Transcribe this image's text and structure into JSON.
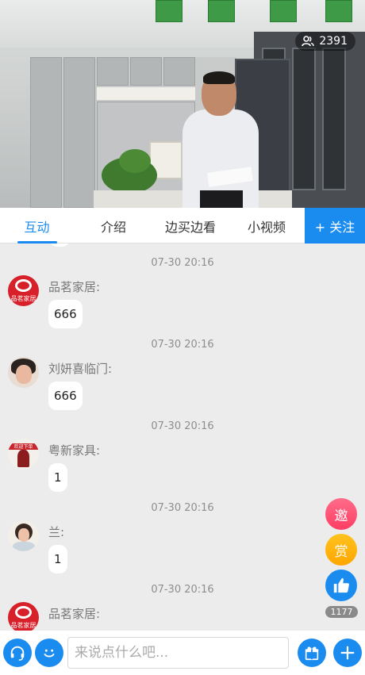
{
  "live": {
    "viewer_count": "2391"
  },
  "tabs": [
    {
      "label": "互动"
    },
    {
      "label": "介绍"
    },
    {
      "label": "边买边看"
    },
    {
      "label": "小视频"
    }
  ],
  "follow_label": "+ 关注",
  "messages": [
    {
      "time": "07-30 20:16",
      "name": "品茗家居:",
      "text": "666",
      "avatar_label": "品茗家居"
    },
    {
      "time": "07-30 20:16",
      "name": "刘妍喜临门:",
      "text": "666"
    },
    {
      "time": "07-30 20:16",
      "name": "粤新家具:",
      "text": "1",
      "avatar_label": "欢迎下单"
    },
    {
      "time": "07-30 20:16",
      "name": "兰:",
      "text": "1"
    },
    {
      "time": "07-30 20:16",
      "name": "品茗家居:",
      "text": "",
      "avatar_label": "品茗家居"
    }
  ],
  "side_actions": {
    "invite_label": "邀",
    "reward_label": "赏",
    "like_count": "1177"
  },
  "composer": {
    "placeholder": "来说点什么吧..."
  },
  "colors": {
    "accent": "#1a8cf0",
    "invite": "#ff3d63",
    "reward": "#ffa600"
  }
}
